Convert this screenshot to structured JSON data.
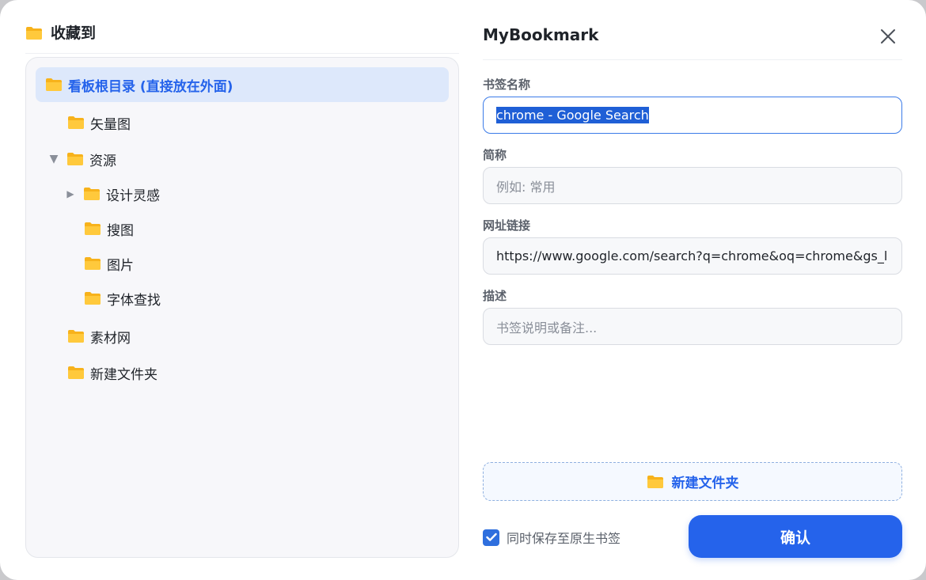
{
  "left_panel": {
    "title": "收藏到",
    "tree": [
      {
        "label": "看板根目录 (直接放在外面)",
        "selected": true
      },
      {
        "label": "矢量图"
      },
      {
        "label": "资源",
        "expanded": true
      },
      {
        "label": "设计灵感",
        "collapsed": true
      },
      {
        "label": "搜图"
      },
      {
        "label": "图片"
      },
      {
        "label": "字体查找"
      },
      {
        "label": "素材网"
      },
      {
        "label": "新建文件夹"
      }
    ]
  },
  "right_panel": {
    "app_title": "MyBookmark",
    "fields": {
      "name_label": "书签名称",
      "name_value": "chrome - Google Search",
      "short_label": "简称",
      "short_placeholder": "例如: 常用",
      "url_label": "网址链接",
      "url_value": "https://www.google.com/search?q=chrome&oq=chrome&gs_l",
      "desc_label": "描述",
      "desc_placeholder": "书签说明或备注..."
    },
    "new_folder_label": "新建文件夹",
    "save_native_label": "同时保存至原生书签",
    "save_native_checked": true,
    "confirm_label": "确认"
  },
  "colors": {
    "accent": "#2563eb",
    "folder": "#f7b21b",
    "selected_bg": "#dde8fb"
  },
  "icons": {
    "folder": "folder-icon",
    "close": "close-icon",
    "expand": "caret-down-icon",
    "collapse": "caret-right-icon",
    "check": "checkmark-icon"
  }
}
